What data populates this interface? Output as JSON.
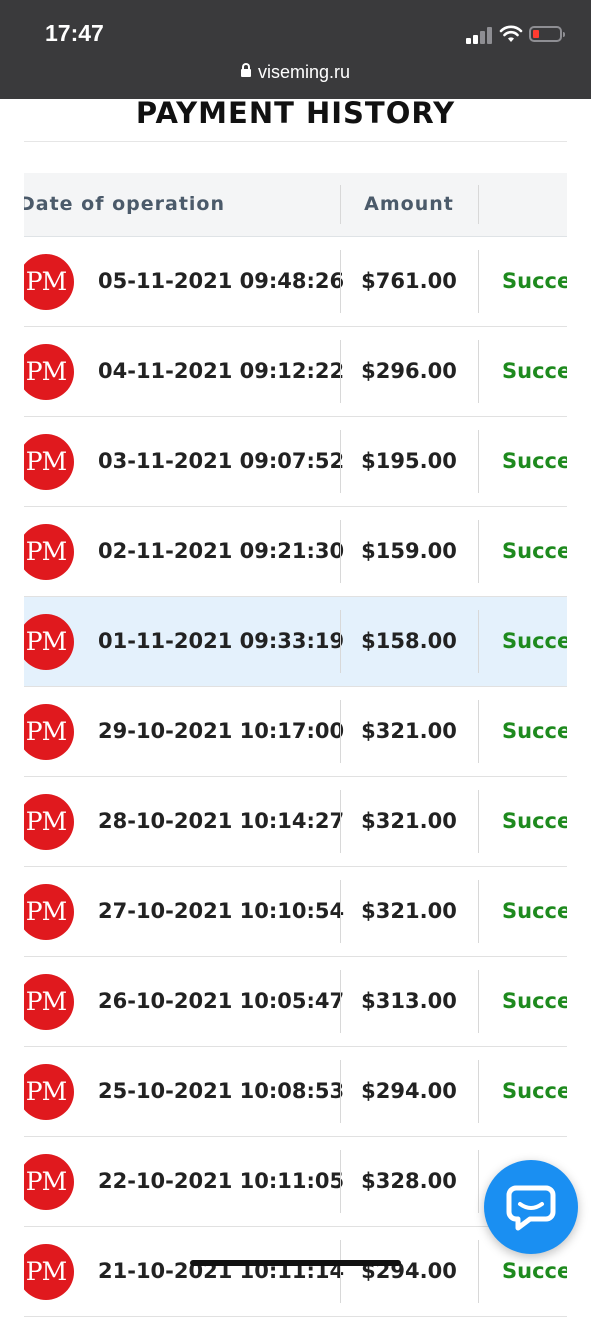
{
  "status_bar": {
    "time": "17:47",
    "url": "viseming.ru",
    "battery_level": 0.15,
    "battery_color": "#ff3b30",
    "icons": [
      "signal-icon",
      "wifi-icon",
      "battery-icon",
      "lock-icon"
    ]
  },
  "page": {
    "title": "PAYMENT HISTORY"
  },
  "table": {
    "headers": {
      "date": "Date of operation",
      "amount": "Amount"
    },
    "rows": [
      {
        "logo": "PM",
        "date": "05-11-2021 09:48:26",
        "amount": "$761.00",
        "status": "Succe"
      },
      {
        "logo": "PM",
        "date": "04-11-2021 09:12:22",
        "amount": "$296.00",
        "status": "Succe"
      },
      {
        "logo": "PM",
        "date": "03-11-2021 09:07:52",
        "amount": "$195.00",
        "status": "Succe"
      },
      {
        "logo": "PM",
        "date": "02-11-2021 09:21:30",
        "amount": "$159.00",
        "status": "Succe"
      },
      {
        "logo": "PM",
        "date": "01-11-2021 09:33:19",
        "amount": "$158.00",
        "status": "Succe"
      },
      {
        "logo": "PM",
        "date": "29-10-2021 10:17:00",
        "amount": "$321.00",
        "status": "Succe"
      },
      {
        "logo": "PM",
        "date": "28-10-2021 10:14:27",
        "amount": "$321.00",
        "status": "Succe"
      },
      {
        "logo": "PM",
        "date": "27-10-2021 10:10:54",
        "amount": "$321.00",
        "status": "Succe"
      },
      {
        "logo": "PM",
        "date": "26-10-2021 10:05:47",
        "amount": "$313.00",
        "status": "Succe"
      },
      {
        "logo": "PM",
        "date": "25-10-2021 10:08:53",
        "amount": "$294.00",
        "status": "Succe"
      },
      {
        "logo": "PM",
        "date": "22-10-2021 10:11:05",
        "amount": "$328.00",
        "status": ""
      },
      {
        "logo": "PM",
        "date": "21-10-2021 10:11:14",
        "amount": "$294.00",
        "status": "Succe"
      }
    ],
    "highlighted_row": 4,
    "colors": {
      "success": "#1e8a1e",
      "pm_brand": "#e0191e",
      "highlight": "#e4f1fc"
    }
  },
  "chat_button": {
    "icon": "chat-bubble-icon",
    "color": "#1a8ff2"
  }
}
